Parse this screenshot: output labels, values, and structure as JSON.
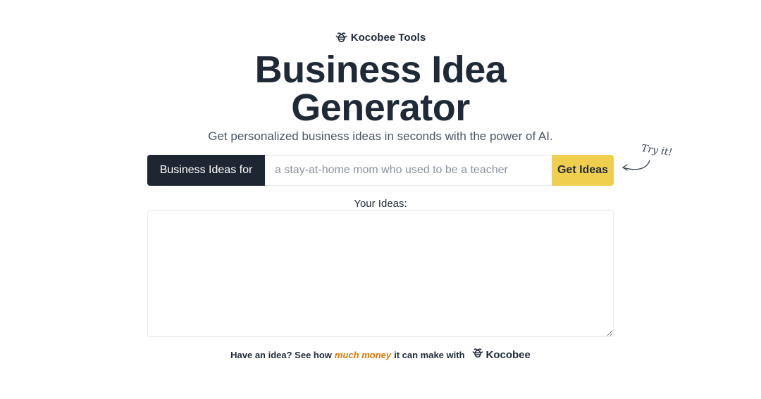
{
  "brand": {
    "name": "Kocobee Tools",
    "icon": "bee-icon"
  },
  "hero": {
    "title_line1": "Business Idea",
    "title_line2": "Generator",
    "subtitle": "Get personalized business ideas in seconds with the power of AI."
  },
  "form": {
    "prefix_label": "Business Ideas for",
    "input_value": "",
    "input_placeholder": "a stay-at-home mom who used to be a teacher",
    "submit_label": "Get Ideas",
    "hint": "Try it!"
  },
  "output": {
    "label": "Your Ideas:",
    "value": ""
  },
  "footer": {
    "text_before": "Have an idea? See how",
    "highlight": "much money",
    "text_after": "it can make with",
    "brand_link": "Kocobee",
    "brand_icon": "bee-icon"
  },
  "colors": {
    "primary_dark": "#1e2533",
    "accent_yellow": "#f0cf4f",
    "highlight_orange": "#d97706",
    "text": "#1f2937",
    "muted": "#4b5563"
  }
}
